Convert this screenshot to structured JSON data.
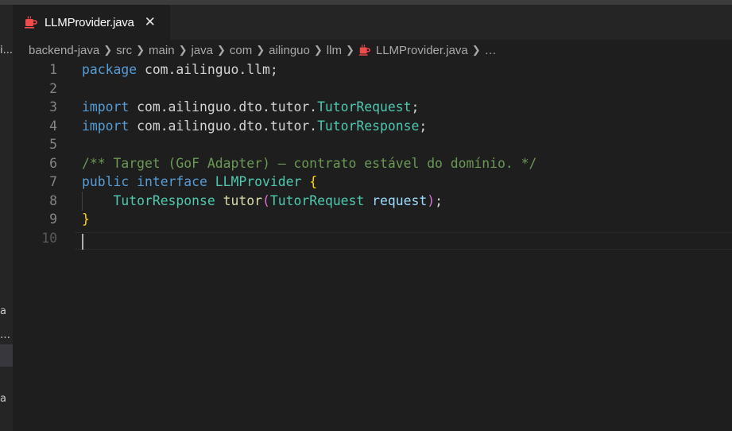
{
  "tab": {
    "label": "LLMProvider.java",
    "close_glyph": "✕",
    "icon": "java-coffee-icon"
  },
  "breadcrumb": {
    "items": [
      "backend-java",
      "src",
      "main",
      "java",
      "com",
      "ailinguo",
      "llm",
      "LLMProvider.java",
      "…"
    ]
  },
  "sidebar": {
    "fragments": [
      "i...",
      "a",
      "…",
      "a"
    ]
  },
  "editor": {
    "lines": [
      {
        "n": "1",
        "tokens": [
          {
            "t": "package",
            "c": "kw"
          },
          {
            "t": " com.ailinguo.llm;",
            "c": "plain"
          }
        ]
      },
      {
        "n": "2",
        "tokens": []
      },
      {
        "n": "3",
        "tokens": [
          {
            "t": "import",
            "c": "kw"
          },
          {
            "t": " com.ailinguo.dto.tutor.",
            "c": "plain"
          },
          {
            "t": "TutorRequest",
            "c": "type"
          },
          {
            "t": ";",
            "c": "plain"
          }
        ]
      },
      {
        "n": "4",
        "tokens": [
          {
            "t": "import",
            "c": "kw"
          },
          {
            "t": " com.ailinguo.dto.tutor.",
            "c": "plain"
          },
          {
            "t": "TutorResponse",
            "c": "type"
          },
          {
            "t": ";",
            "c": "plain"
          }
        ]
      },
      {
        "n": "5",
        "tokens": []
      },
      {
        "n": "6",
        "tokens": [
          {
            "t": "/** Target (GoF Adapter) — contrato estável do domínio. */",
            "c": "cmt"
          }
        ]
      },
      {
        "n": "7",
        "tokens": [
          {
            "t": "public",
            "c": "kw"
          },
          {
            "t": " ",
            "c": "plain"
          },
          {
            "t": "interface",
            "c": "kw"
          },
          {
            "t": " ",
            "c": "plain"
          },
          {
            "t": "LLMProvider",
            "c": "type"
          },
          {
            "t": " ",
            "c": "plain"
          },
          {
            "t": "{",
            "c": "brace"
          }
        ]
      },
      {
        "n": "8",
        "tokens": [
          {
            "t": "    ",
            "c": "plain"
          },
          {
            "t": "TutorResponse",
            "c": "type"
          },
          {
            "t": " ",
            "c": "plain"
          },
          {
            "t": "tutor",
            "c": "fn"
          },
          {
            "t": "(",
            "c": "paren"
          },
          {
            "t": "TutorRequest",
            "c": "type"
          },
          {
            "t": " ",
            "c": "plain"
          },
          {
            "t": "request",
            "c": "param"
          },
          {
            "t": ")",
            "c": "paren"
          },
          {
            "t": ";",
            "c": "plain"
          }
        ]
      },
      {
        "n": "9",
        "tokens": [
          {
            "t": "}",
            "c": "brace"
          }
        ]
      },
      {
        "n": "10",
        "tokens": []
      }
    ],
    "active_line": "10"
  },
  "colors": {
    "editor_bg": "#1e1e1e",
    "tab_bar_bg": "#252526",
    "keyword": "#569cd6",
    "type": "#4ec9b0",
    "function": "#dcdcaa",
    "parameter": "#9cdcfe",
    "comment": "#6a9955",
    "brace": "#ffd700",
    "paren": "#da70d6",
    "java_icon": "#f14c4c"
  }
}
